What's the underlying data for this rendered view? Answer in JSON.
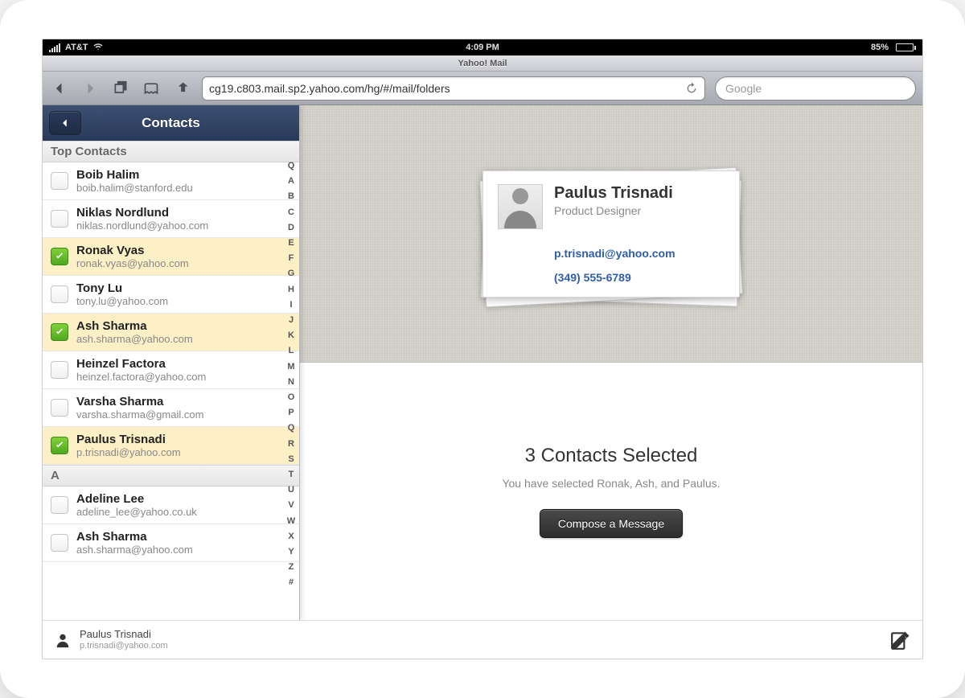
{
  "statusbar": {
    "carrier": "AT&T",
    "time": "4:09 PM",
    "battery_pct": "85%"
  },
  "browser": {
    "title": "Yahoo! Mail",
    "url": "cg19.c803.mail.sp2.yahoo.com/hg/#/mail/folders",
    "search_placeholder": "Google"
  },
  "sidebar": {
    "title": "Contacts",
    "section_top": "Top Contacts",
    "section_a": "A",
    "index": [
      "Q",
      "A",
      "B",
      "C",
      "D",
      "E",
      "F",
      "G",
      "H",
      "I",
      "J",
      "K",
      "L",
      "M",
      "N",
      "O",
      "P",
      "Q",
      "R",
      "S",
      "T",
      "U",
      "V",
      "W",
      "X",
      "Y",
      "Z",
      "#"
    ],
    "contacts_top": [
      {
        "name": "Boib Halim",
        "email": "boib.halim@stanford.edu",
        "selected": false
      },
      {
        "name": "Niklas Nordlund",
        "email": "niklas.nordlund@yahoo.com",
        "selected": false
      },
      {
        "name": "Ronak Vyas",
        "email": "ronak.vyas@yahoo.com",
        "selected": true
      },
      {
        "name": "Tony Lu",
        "email": "tony.lu@yahoo.com",
        "selected": false
      },
      {
        "name": "Ash Sharma",
        "email": "ash.sharma@yahoo.com",
        "selected": true
      },
      {
        "name": "Heinzel Factora",
        "email": "heinzel.factora@yahoo.com",
        "selected": false
      },
      {
        "name": "Varsha Sharma",
        "email": "varsha.sharma@gmail.com",
        "selected": false
      },
      {
        "name": "Paulus Trisnadi",
        "email": "p.trisnadi@yahoo.com",
        "selected": true
      }
    ],
    "contacts_a": [
      {
        "name": "Adeline Lee",
        "email": "adeline_lee@yahoo.co.uk",
        "selected": false
      },
      {
        "name": "Ash Sharma",
        "email": "ash.sharma@yahoo.com",
        "selected": false
      }
    ]
  },
  "card": {
    "name": "Paulus Trisnadi",
    "role": "Product Designer",
    "email": "p.trisnadi@yahoo.com",
    "phone": "(349) 555-6789"
  },
  "summary": {
    "title": "3 Contacts Selected",
    "subtitle": "You have selected Ronak, Ash, and Paulus.",
    "button": "Compose a Message"
  },
  "footer": {
    "name": "Paulus Trisnadi",
    "email": "p.trisnadi@yahoo.com"
  }
}
